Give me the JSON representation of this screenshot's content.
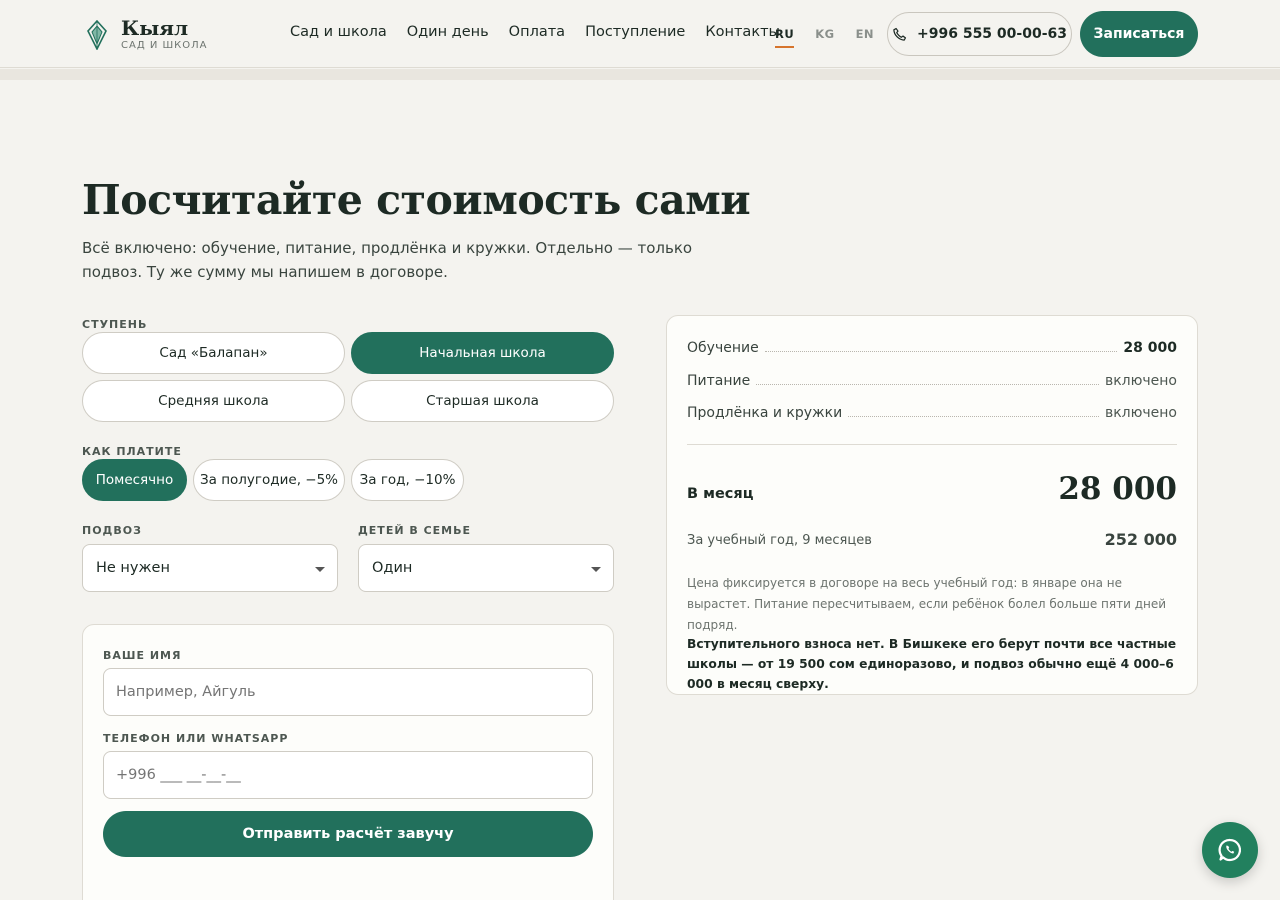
{
  "header": {
    "logo_name": "Кыял",
    "logo_sub": "САД И ШКОЛА",
    "nav": [
      "Сад и школа",
      "Один день",
      "Оплата",
      "Поступление",
      "Контакты"
    ],
    "languages": [
      "RU",
      "KG",
      "EN"
    ],
    "active_language": "RU",
    "phone": "+996 555 00-00-63",
    "signup_label": "Записаться"
  },
  "hero": {
    "title": "Посчитайте стоимость сами",
    "lead": "Всё включено: обучение, питание, продлёнка и кружки. Отдельно — только подвоз. Ту же сумму мы напишем в договоре."
  },
  "calculator": {
    "stage_label": "СТУПЕНЬ",
    "stages": [
      "Сад «Балапан»",
      "Начальная школа",
      "Средняя школа",
      "Старшая школа"
    ],
    "active_stage": "Начальная школа",
    "payment_label": "КАК ПЛАТИТЕ",
    "payments": [
      "Помесячно",
      "За полугодие, −5%",
      "За год, −10%"
    ],
    "active_payment": "Помесячно",
    "transport_label": "ПОДВОЗ",
    "transport_value": "Не нужен",
    "kids_label": "ДЕТЕЙ В СЕМЬЕ",
    "kids_value": "Один"
  },
  "form": {
    "name_label": "ВАШЕ ИМЯ",
    "name_placeholder": "Например, Айгуль",
    "phone_label": "ТЕЛЕФОН ИЛИ WHATSAPP",
    "phone_placeholder": "+996 ___ __-__-__",
    "submit_label": "Отправить расчёт завучу"
  },
  "summary": {
    "lines": [
      {
        "label": "Обучение",
        "value": "28 000"
      },
      {
        "label": "Питание",
        "value": "включено"
      },
      {
        "label": "Продлёнка и кружки",
        "value": "включено"
      }
    ],
    "month_label": "В месяц",
    "month_value": "28 000",
    "year_label": "За учебный год, 9 месяцев",
    "year_value": "252 000",
    "note": "Цена фиксируется в договоре на весь учебный год: в январе она не вырастет. Питание пересчитываем, если ребёнок болел больше пяти дней подряд.",
    "note2": "Вступительного взноса нет. В Бишкеке его берут почти все частные школы — от 19 500 сом единоразово, и подвоз обычно ещё 4 000–6 000 в месяц сверху."
  },
  "colors": {
    "brand": "#22705c",
    "accent": "#d6742c",
    "background": "#f4f3ef"
  },
  "icons": {
    "logo": "gem-icon",
    "phone": "phone-icon",
    "whatsapp": "whatsapp-icon",
    "select_caret": "caret-down-icon"
  }
}
